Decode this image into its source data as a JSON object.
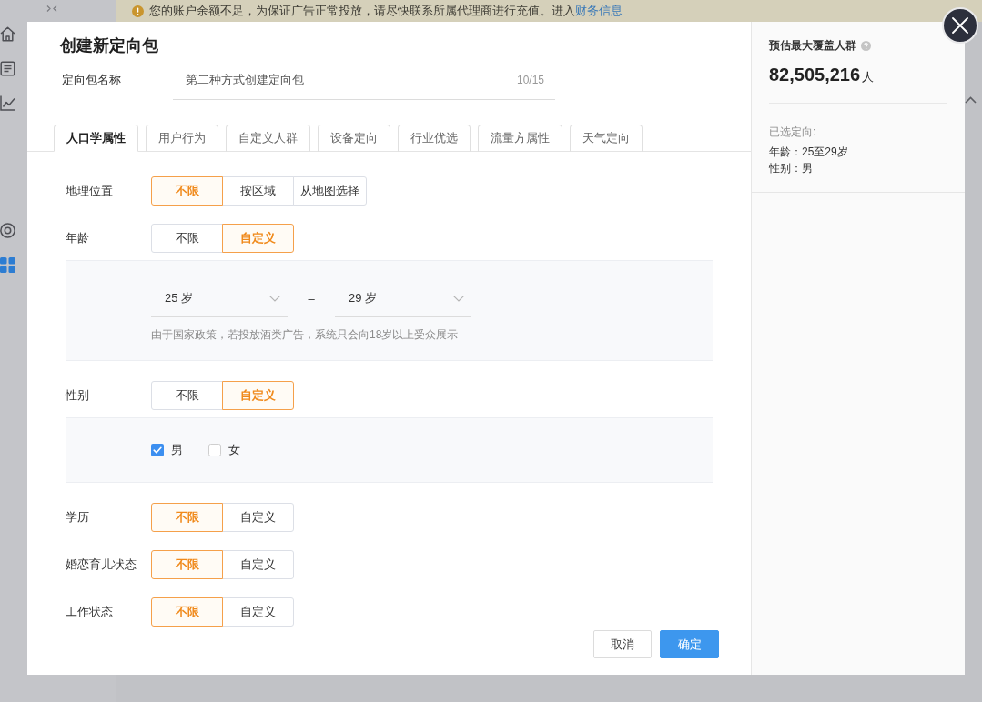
{
  "sidebar": {
    "items": [
      {
        "selected": false
      },
      {
        "selected": false
      },
      {
        "selected": false
      },
      {
        "selected": false
      },
      {
        "selected": true
      }
    ]
  },
  "banner": {
    "message": "您的账户余额不足，为保证广告正常投放，请尽快联系所属代理商进行充值。进入",
    "link": "财务信息"
  },
  "modal": {
    "title": "创建新定向包",
    "name_field": {
      "label": "定向包名称",
      "value": "第二种方式创建定向包",
      "counter": "10/15"
    },
    "tabs": [
      {
        "label": "人口学属性",
        "selected": true
      },
      {
        "label": "用户行为",
        "selected": false
      },
      {
        "label": "自定义人群",
        "selected": false
      },
      {
        "label": "设备定向",
        "selected": false
      },
      {
        "label": "行业优选",
        "selected": false
      },
      {
        "label": "流量方属性",
        "selected": false
      },
      {
        "label": "天气定向",
        "selected": false
      }
    ],
    "fields": [
      {
        "label": "地理位置",
        "options": [
          {
            "label": "不限",
            "selected": true
          },
          {
            "label": "按区域",
            "selected": false
          },
          {
            "label": "从地图选择",
            "selected": false
          }
        ]
      },
      {
        "label": "年龄",
        "options": [
          {
            "label": "不限",
            "selected": false
          },
          {
            "label": "自定义",
            "selected": true
          }
        ],
        "panel": {
          "kind": "range",
          "from": "25 岁",
          "separator": "–",
          "to": "29 岁",
          "note": "由于国家政策，若投放酒类广告，系统只会向18岁以上受众展示"
        }
      },
      {
        "label": "性别",
        "options": [
          {
            "label": "不限",
            "selected": false
          },
          {
            "label": "自定义",
            "selected": true
          }
        ],
        "panel": {
          "kind": "checkboxes",
          "items": [
            {
              "label": "男",
              "checked": true
            },
            {
              "label": "女",
              "checked": false
            }
          ]
        }
      },
      {
        "label": "学历",
        "options": [
          {
            "label": "不限",
            "selected": true
          },
          {
            "label": "自定义",
            "selected": false
          }
        ]
      },
      {
        "label": "婚恋育儿状态",
        "options": [
          {
            "label": "不限",
            "selected": true
          },
          {
            "label": "自定义",
            "selected": false
          }
        ]
      },
      {
        "label": "工作状态",
        "options": [
          {
            "label": "不限",
            "selected": true
          },
          {
            "label": "自定义",
            "selected": false
          }
        ]
      }
    ],
    "buttons": [
      {
        "label": "取消",
        "kind": "secondary"
      },
      {
        "label": "确定",
        "kind": "primary"
      }
    ]
  },
  "summary": {
    "title": "预估最大覆盖人群",
    "count": "82,505,216",
    "unit": "人",
    "selected_title": "已选定向:",
    "selected_items": [
      "年龄：25至29岁",
      "性别：男"
    ]
  }
}
